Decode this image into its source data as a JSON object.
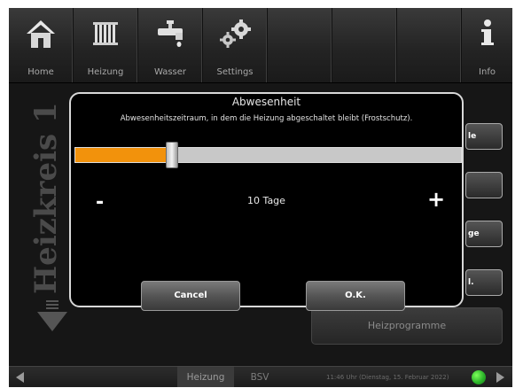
{
  "nav": {
    "items": [
      {
        "label": "Home",
        "icon": "home-icon"
      },
      {
        "label": "Heizung",
        "icon": "radiator-icon"
      },
      {
        "label": "Wasser",
        "icon": "faucet-icon"
      },
      {
        "label": "Settings",
        "icon": "gears-icon"
      },
      {
        "label": "",
        "icon": ""
      },
      {
        "label": "",
        "icon": ""
      },
      {
        "label": "",
        "icon": ""
      },
      {
        "label": "Info",
        "icon": "info-icon"
      }
    ]
  },
  "main": {
    "side_title": "Heizkreis 1",
    "side_buttons": [
      "le",
      "",
      "ge",
      "l."
    ],
    "program_button": "Heizprogramme"
  },
  "dialog": {
    "title": "Abwesenheit",
    "subtitle": "Abwesenheitszeitraum, in dem die Heizung abgeschaltet bleibt (Frostschutz).",
    "slider_fraction": 0.25,
    "minus": "-",
    "plus": "+",
    "value": "10 Tage",
    "cancel": "Cancel",
    "ok": "O.K."
  },
  "bottom": {
    "tabs": [
      "Heizung",
      "BSV"
    ],
    "active_tab": "Heizung",
    "status": "11:46 Uhr (Dienstag, 15. Februar 2022)"
  },
  "colors": {
    "accent": "#f2920c",
    "background": "#161616"
  }
}
